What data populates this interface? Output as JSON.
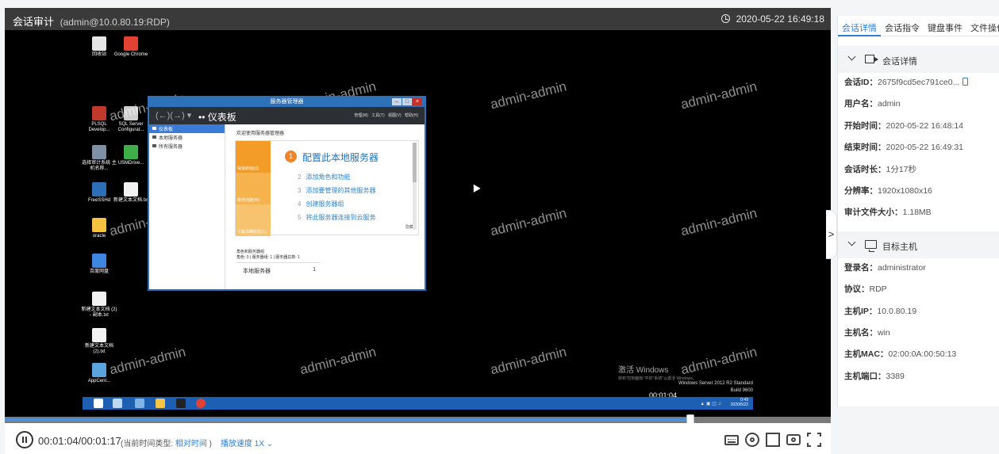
{
  "topbar": {
    "title": "会话审计",
    "subtitle": "(admin@10.0.80.19:RDP)",
    "datetime": "2020-05-22 16:49:18"
  },
  "desktop": {
    "icons": [
      {
        "label": "回收站",
        "color": "#e6e6e6"
      },
      {
        "label": "Google Chrome",
        "color": "#e34133"
      },
      {
        "label": "PLSQL Develop...",
        "color": "#c0392b"
      },
      {
        "label": "SQL Server Configurat...",
        "color": "#cfcfcf"
      },
      {
        "label": "选择审计系统 主机名称...",
        "color": "#7f8fa6"
      },
      {
        "label": "USMDrive...",
        "color": "#3fae49"
      },
      {
        "label": "FreeSSHd",
        "color": "#2d6fb7"
      },
      {
        "label": "新建文本文档.txt",
        "color": "#f2f2f2"
      },
      {
        "label": "oracle",
        "color": "#f5c242"
      },
      {
        "label": "百度网盘",
        "color": "#3f86e3"
      },
      {
        "label": "新建文本文档 (2) - 副本.txt",
        "color": "#f2f2f2"
      },
      {
        "label": "新建文本文档 (2).txt",
        "color": "#f2f2f2"
      },
      {
        "label": "AppCent...",
        "color": "#5aa3dc"
      }
    ],
    "watermark": "admin-admin",
    "activate_line1": "激活 Windows",
    "activate_line2": "转到\"控制面板\"中的\"系统\"以激活 Windows。",
    "windows_version": "Windows Server 2012 R2 Standard",
    "build": "Build 9600",
    "overlay_time": "00:01:04",
    "tray_time": "0:49",
    "tray_date": "2020/5/22"
  },
  "server_manager": {
    "window_title": "服务器管理器",
    "header_title": "•• 仪表板",
    "menu": "管理(M)  工具(T)  视图(V)  帮助(H)",
    "sidebar": [
      "仪表板",
      "本地服务器",
      "所有服务器"
    ],
    "welcome": "欢迎使用服务器管理器",
    "tiles": [
      "快速启动(Q)",
      "新增功能(W)",
      "了解详细信息(L)"
    ],
    "main_task_num": "1",
    "main_task": "配置此本地服务器",
    "steps": [
      {
        "num": "2",
        "text": "添加角色和功能"
      },
      {
        "num": "3",
        "text": "添加要管理的其他服务器"
      },
      {
        "num": "4",
        "text": "创建服务器组"
      },
      {
        "num": "5",
        "text": "将此服务器连接到云服务"
      }
    ],
    "hide": "隐藏",
    "roles_title": "角色和服务器组",
    "roles_sub": "角色: 0 | 服务器组: 1 | 服务器总数: 1",
    "role_name": "本地服务器",
    "role_count": "1"
  },
  "playback": {
    "current": "00:01:04",
    "total": "00:01:17",
    "time_display": "00:01:04/00:01:17",
    "time_type_label": "(当前时间类型:",
    "time_type_value": "相对时间",
    "time_type_close": ")",
    "speed": "播放速度 1X",
    "progress_fraction": 0.83
  },
  "tabs": [
    "会话详情",
    "会话指令",
    "键盘事件",
    "文件操作"
  ],
  "session_section": {
    "title": "会话详情",
    "fields": [
      {
        "k": "会话ID：",
        "v": "2675f9cd5ec791ce0..."
      },
      {
        "k": "用户名：",
        "v": "admin"
      },
      {
        "k": "开始时间：",
        "v": "2020-05-22 16:48:14"
      },
      {
        "k": "结束时间：",
        "v": "2020-05-22 16:49:31"
      },
      {
        "k": "会话时长：",
        "v": "1分17秒"
      },
      {
        "k": "分辨率：",
        "v": "1920x1080x16"
      },
      {
        "k": "审计文件大小：",
        "v": "1.18MB"
      }
    ]
  },
  "host_section": {
    "title": "目标主机",
    "fields": [
      {
        "k": "登录名：",
        "v": "administrator"
      },
      {
        "k": "协议：",
        "v": "RDP"
      },
      {
        "k": "主机IP：",
        "v": "10.0.80.19"
      },
      {
        "k": "主机名：",
        "v": "win"
      },
      {
        "k": "主机MAC：",
        "v": "02:00:0A:00:50:13"
      },
      {
        "k": "主机端口：",
        "v": "3389"
      }
    ]
  },
  "collapse_glyph": ">"
}
